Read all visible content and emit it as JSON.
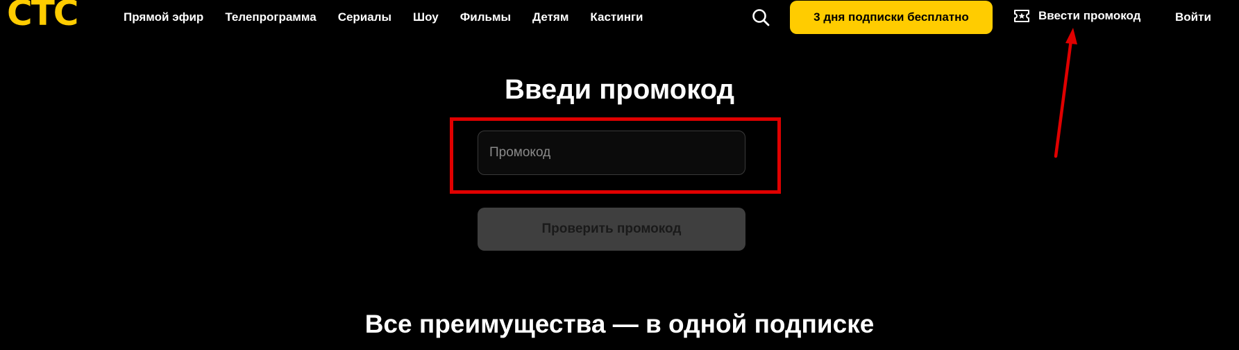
{
  "header": {
    "logo": "СТС",
    "nav": [
      {
        "label": "Прямой эфир"
      },
      {
        "label": "Телепрограмма"
      },
      {
        "label": "Сериалы"
      },
      {
        "label": "Шоу"
      },
      {
        "label": "Фильмы"
      },
      {
        "label": "Детям"
      },
      {
        "label": "Кастинги"
      }
    ],
    "search_icon": "search-icon",
    "trial_button": "3 дня подписки бесплатно",
    "promo_link": {
      "icon": "ticket-star-icon",
      "label": "Ввести промокод"
    },
    "login": "Войти"
  },
  "main": {
    "title": "Введи промокод",
    "promo_input": {
      "value": "",
      "placeholder": "Промокод"
    },
    "check_button": "Проверить промокод",
    "section_title": "Все преимущества — в одной подписке"
  },
  "colors": {
    "background": "#000000",
    "brand_yellow": "#ffcc00",
    "annotation_red": "#e00000",
    "disabled_button": "#3f3f3f"
  }
}
